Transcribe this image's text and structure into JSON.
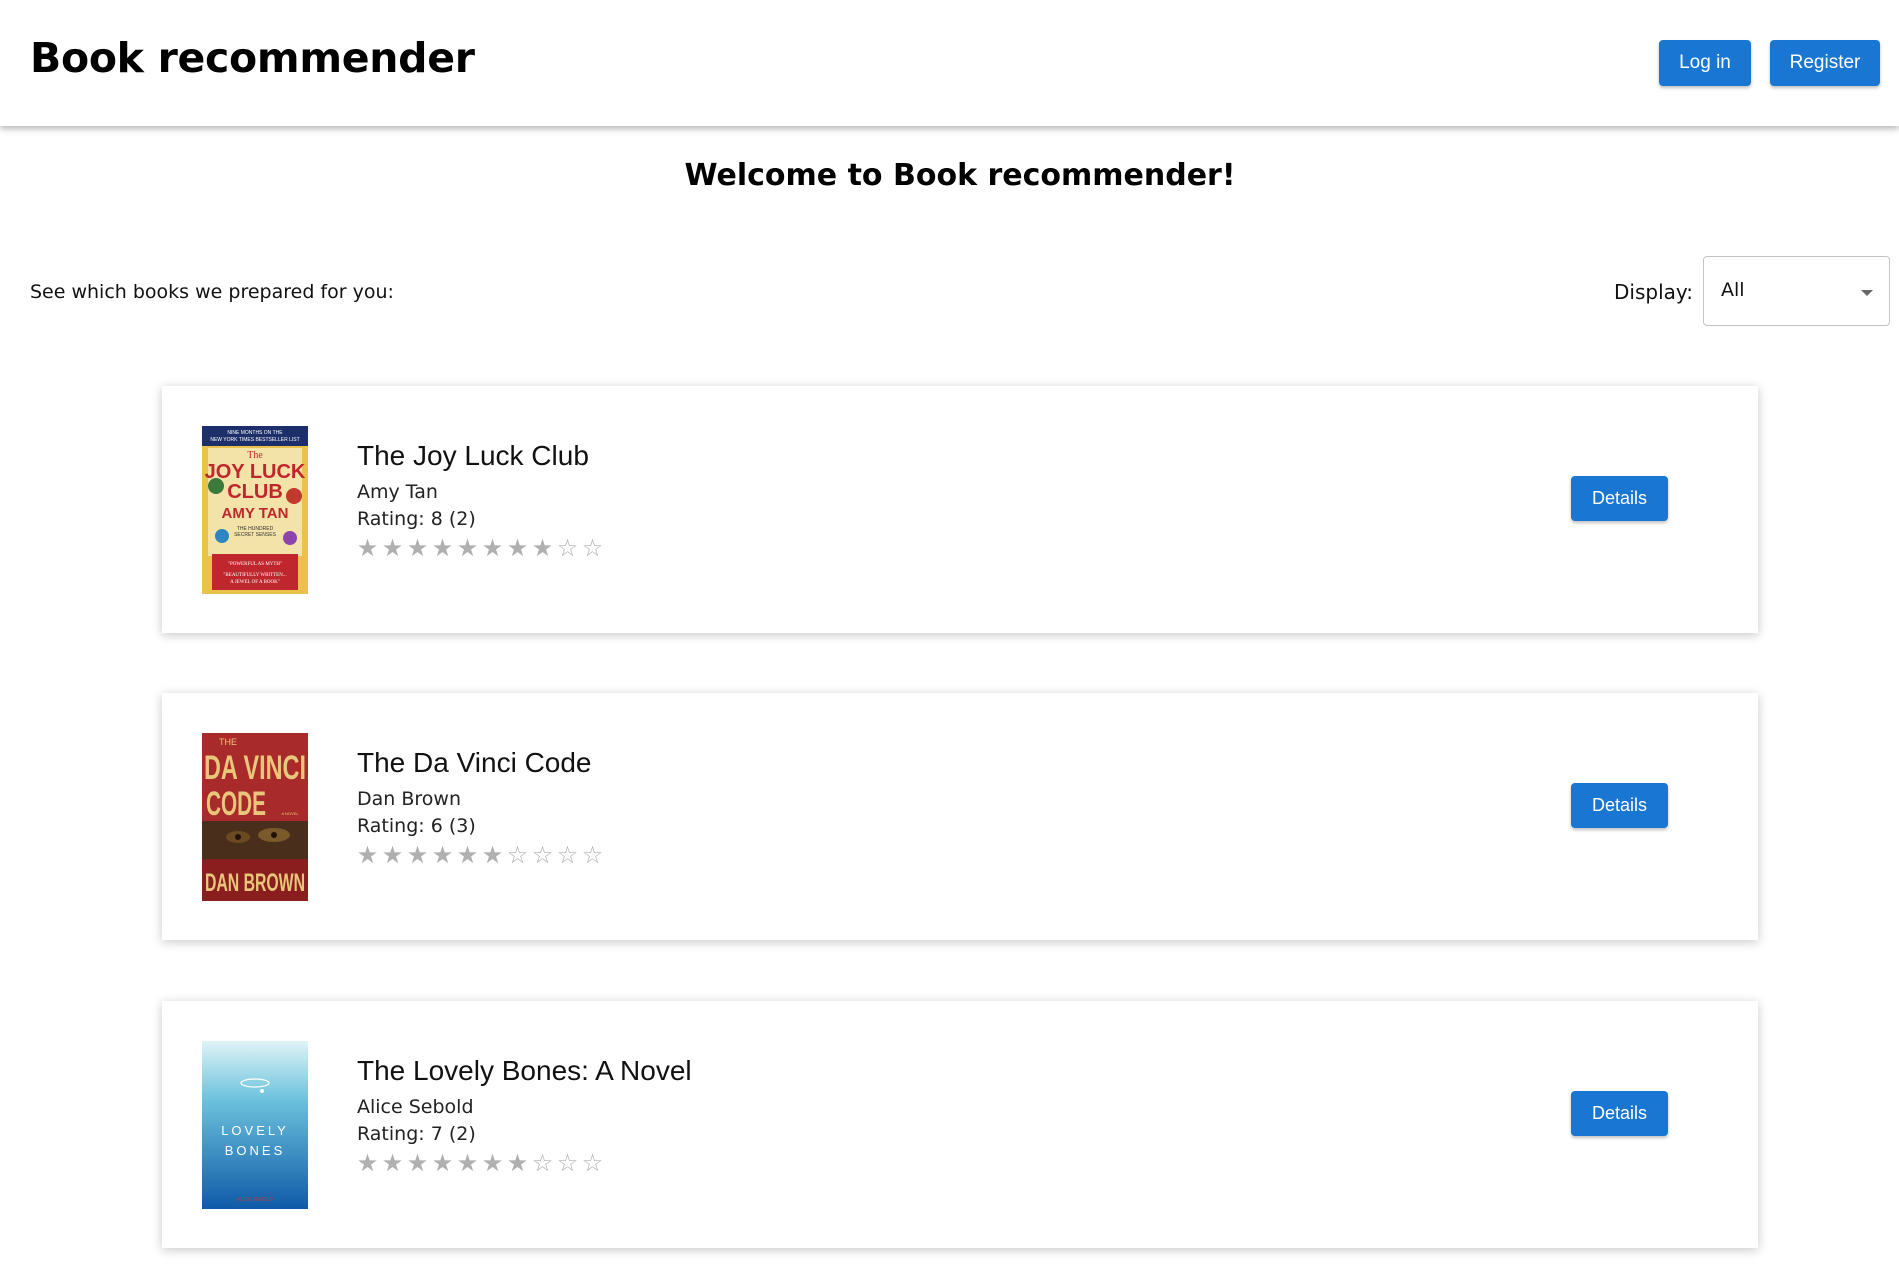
{
  "app": {
    "title": "Book recommender",
    "login_label": "Log in",
    "register_label": "Register",
    "accent": "#1976d2"
  },
  "main": {
    "welcome": "Welcome to Book recommender!",
    "intro": "See which books we prepared for you:",
    "display_label": "Display:",
    "display_value": "All"
  },
  "books": [
    {
      "title": "The Joy Luck Club",
      "author": "Amy Tan",
      "rating_text": "Rating: 8 (2)",
      "rating": 8,
      "max_rating": 10,
      "details_label": "Details",
      "cover_text": [
        "NINE MONTHS ON THE NEW YORK TIMES BESTSELLER LIST",
        "The",
        "JOY LUCK",
        "CLUB",
        "AMY TAN",
        "THE HUNDRED SECRET SENSES",
        "\"POWERFUL AS MYTH\"",
        "\"BEAUTIFULLY WRITTEN... A JEWEL OF A BOOK\""
      ]
    },
    {
      "title": "The Da Vinci Code",
      "author": "Dan Brown",
      "rating_text": "Rating: 6 (3)",
      "rating": 6,
      "max_rating": 10,
      "details_label": "Details",
      "cover_text": [
        "THE",
        "DA VINCI",
        "CODE",
        "A NOVEL",
        "DAN BROWN"
      ]
    },
    {
      "title": "The Lovely Bones: A Novel",
      "author": "Alice Sebold",
      "rating_text": "Rating: 7 (2)",
      "rating": 7,
      "max_rating": 10,
      "details_label": "Details",
      "cover_text": [
        "LOVELY",
        "BONES",
        "ALICE SEBOLD"
      ]
    }
  ],
  "icons": {
    "star_filled": "star-filled-icon",
    "star_empty": "star-empty-icon",
    "dropdown": "chevron-down-icon"
  }
}
